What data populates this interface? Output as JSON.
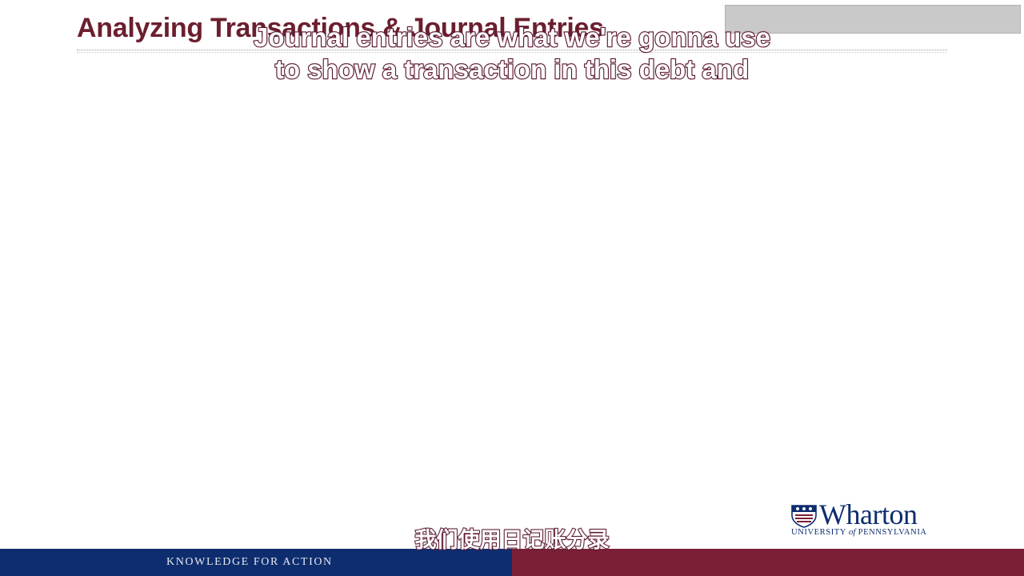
{
  "slide": {
    "title": "Analyzing Transactions & Journal Entries"
  },
  "subtitles": {
    "english_line1": "Journal entries are what we're gonna use",
    "english_line2": "to show a transaction in this debt and",
    "chinese": "我们使用日记账分录"
  },
  "footer": {
    "tagline": "KNOWLEDGE FOR ACTION"
  },
  "logo": {
    "wordmark": "Wharton",
    "university_pre": "UNIVERSITY ",
    "university_of": "of",
    "university_post": " PENNSYLVANIA",
    "icon": "penn-shield-icon"
  },
  "colors": {
    "title": "#6b1f2e",
    "footer_blue": "#0e2d6e",
    "footer_red": "#7a1f35",
    "subtitle_outline": "#5c1a34"
  }
}
